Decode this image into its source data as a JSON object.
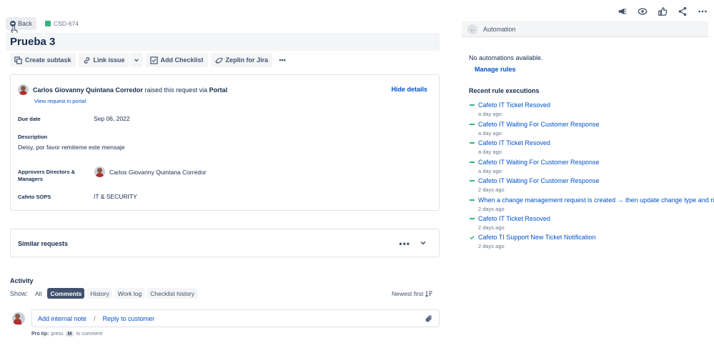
{
  "header": {
    "back_label": "Back",
    "issue_key": "CSD-674",
    "title": "Prueba 3"
  },
  "toolbar": {
    "create_subtask": "Create subtask",
    "link_issue": "Link issue",
    "add_checklist": "Add Checklist",
    "zeplin": "Zeplin for Jira",
    "more": "•••"
  },
  "request": {
    "raiser_name": "Carlos Giovanny Quintana Corredor",
    "raised_text": "raised this request via",
    "channel": "Portal",
    "view_portal": "View request in portal",
    "hide_details": "Hide details",
    "due_date_label": "Due date",
    "due_date": "Sep 06, 2022",
    "description_label": "Description",
    "description": "Deisy, por favor remiteme este mensaje",
    "approvers_label": "Approvers Directors & Managers",
    "approver_name": "Carlos Giovanny Quintana Corredor",
    "sops_label": "Cafeto SOPS",
    "sops_value": "IT & SECURITY"
  },
  "similar": {
    "label": "Similar requests",
    "more": "•••"
  },
  "activity": {
    "title": "Activity",
    "show_label": "Show:",
    "filters": [
      "All",
      "Comments",
      "History",
      "Work log",
      "Checklist history"
    ],
    "active_filter": "Comments",
    "sort": "Newest first",
    "add_internal_note": "Add internal note",
    "separator": "/",
    "reply_customer": "Reply to customer",
    "protip_prefix": "Pro tip:",
    "protip_press": "press",
    "protip_key": "M",
    "protip_suffix": "to comment"
  },
  "automation": {
    "title": "Automation",
    "no_automations": "No automations available.",
    "manage_rules": "Manage rules",
    "recent_title": "Recent rule executions",
    "executions": [
      {
        "name": "Cafeto IT Ticket Resoved",
        "time": "a day ago",
        "status": "dash"
      },
      {
        "name": "Cafeto IT Waiting For Customer Response",
        "time": "a day ago",
        "status": "dash"
      },
      {
        "name": "Cafeto IT Ticket Resoved",
        "time": "a day ago",
        "status": "dash"
      },
      {
        "name": "Cafeto IT Waiting For Customer Response",
        "time": "a day ago",
        "status": "dash"
      },
      {
        "name": "Cafeto IT Waiting For Customer Response",
        "time": "2 days ago",
        "status": "dash"
      },
      {
        "name": "When a change management request is created → then update change type and risk",
        "time": "2 days ago",
        "status": "dash"
      },
      {
        "name": "Cafeto IT Ticket Resoved",
        "time": "2 days ago",
        "status": "dash"
      },
      {
        "name": "Cafeto TI Support New Ticket Notification",
        "time": "2 days ago",
        "status": "check"
      }
    ]
  },
  "colors": {
    "link": "#0052cc",
    "success": "#36b37e",
    "text": "#172b4d",
    "subtle": "#6b778c"
  }
}
